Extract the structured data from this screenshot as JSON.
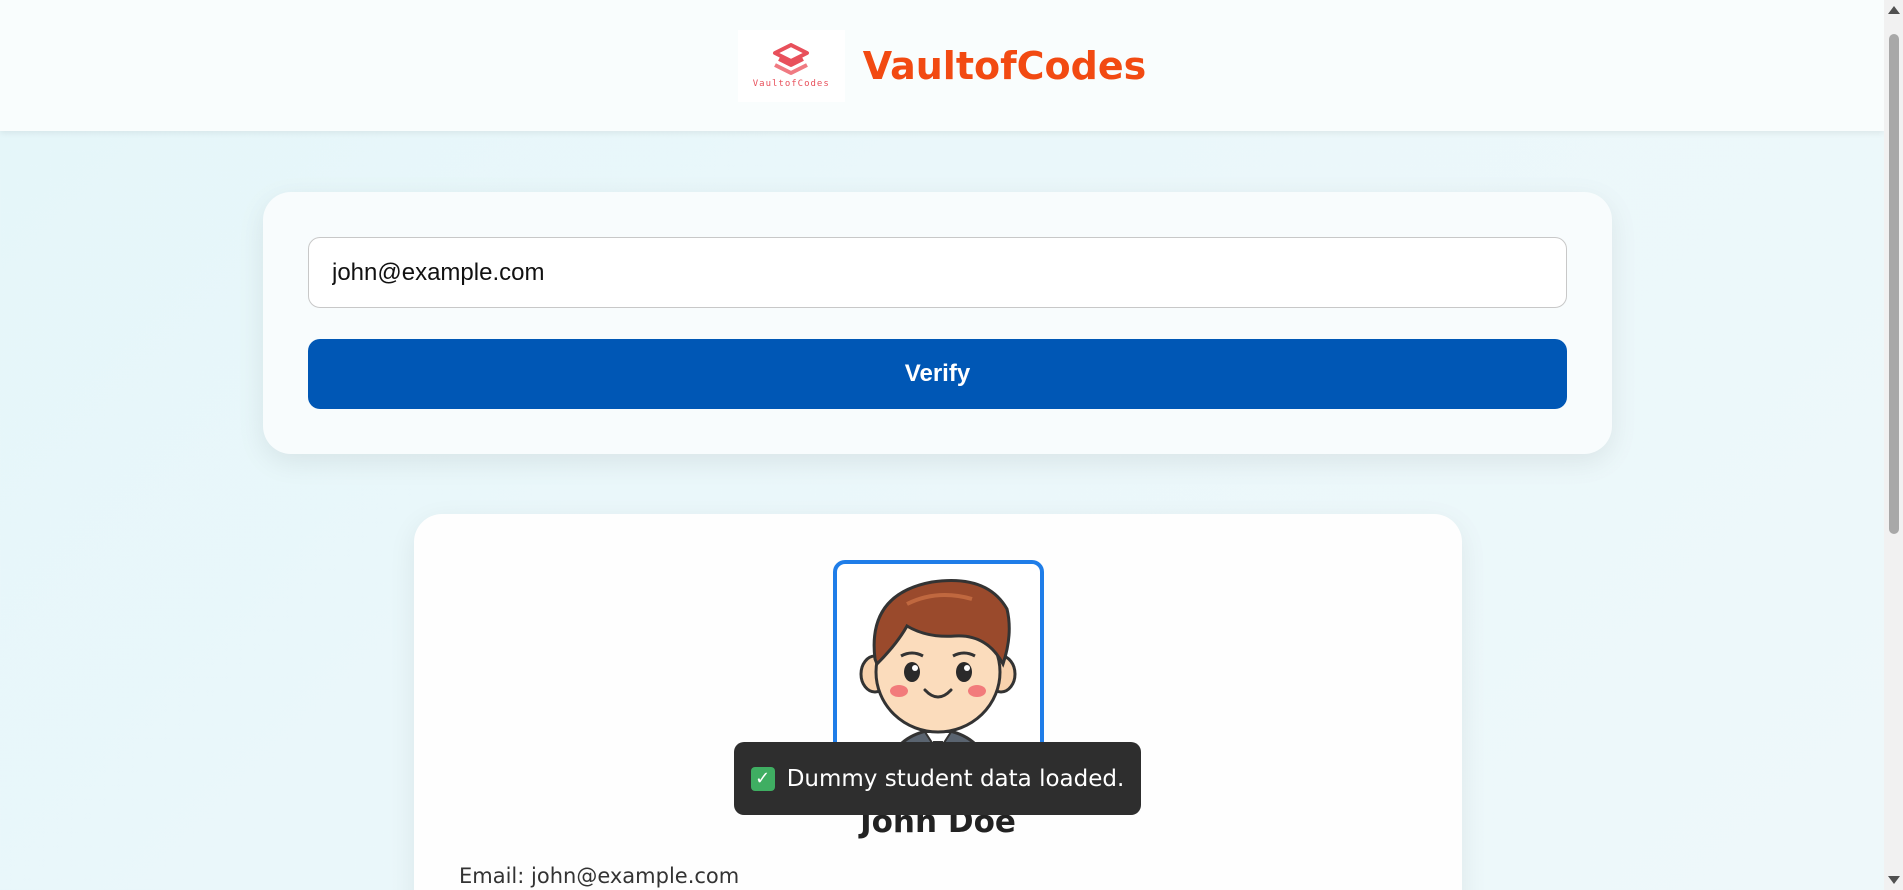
{
  "header": {
    "brand_name": "VaultofCodes",
    "logo_text": "VaultofCodes",
    "brand_color": "#f24a12"
  },
  "verify": {
    "email_value": "john@example.com",
    "button_label": "Verify",
    "button_color": "#0057b5"
  },
  "student": {
    "name": "John Doe",
    "email_line": "Email: john@example.com",
    "avatar_icon": "cartoon-student-avatar"
  },
  "toast": {
    "message": "Dummy student data loaded.",
    "icon": "check-mark-icon"
  }
}
